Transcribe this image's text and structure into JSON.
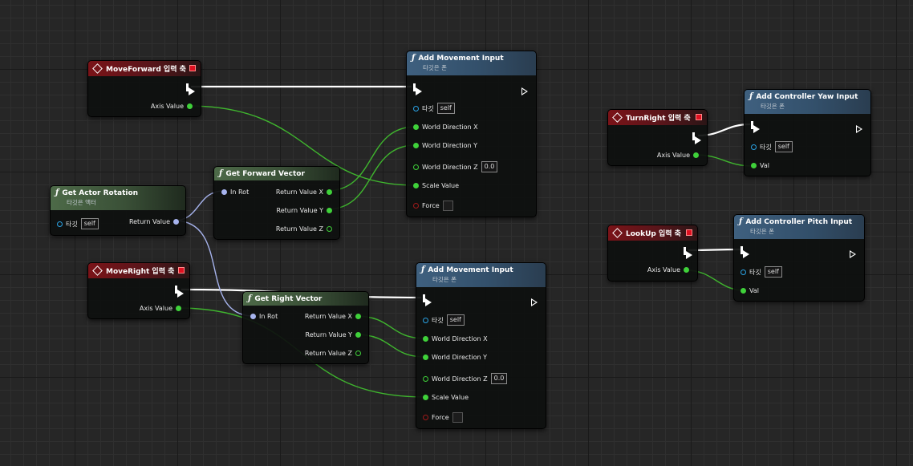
{
  "pin_labels": {
    "axis_value": "Axis Value",
    "target": "타깃",
    "world_dir_x": "World Direction X",
    "world_dir_y": "World Direction Y",
    "world_dir_z": "World Direction Z",
    "scale_value": "Scale Value",
    "force": "Force",
    "in_rot": "In Rot",
    "return_value": "Return Value",
    "return_x": "Return Value X",
    "return_y": "Return Value Y",
    "return_z": "Return Value Z",
    "val": "Val"
  },
  "defaults": {
    "self": "self",
    "zero": "0.0"
  },
  "nodes": {
    "moveforward": {
      "title": "MoveForward 입력 축"
    },
    "moveright": {
      "title": "MoveRight 입력 축"
    },
    "turnright": {
      "title": "TurnRight 입력 축"
    },
    "lookup": {
      "title": "LookUp 입력 축"
    },
    "get_actor_rotation": {
      "title": "Get Actor Rotation",
      "subtitle": "타깃은 액터"
    },
    "get_forward_vector": {
      "title": "Get Forward Vector"
    },
    "get_right_vector": {
      "title": "Get Right Vector"
    },
    "add_movement_1": {
      "title": "Add Movement Input",
      "subtitle": "타깃은 폰"
    },
    "add_movement_2": {
      "title": "Add Movement Input",
      "subtitle": "타깃은 폰"
    },
    "add_yaw": {
      "title": "Add Controller Yaw Input",
      "subtitle": "타깃은 폰"
    },
    "add_pitch": {
      "title": "Add Controller Pitch Input",
      "subtitle": "타깃은 폰"
    }
  },
  "colors": {
    "event_header": "#7a1318",
    "pure_function_header": "#4d6a48",
    "function_header": "#3f607f",
    "float_pin": "#3fd13a",
    "rotator_pin": "#a7b4ee",
    "object_pin": "#2aa4e6",
    "exec_wire": "#ffffff"
  }
}
